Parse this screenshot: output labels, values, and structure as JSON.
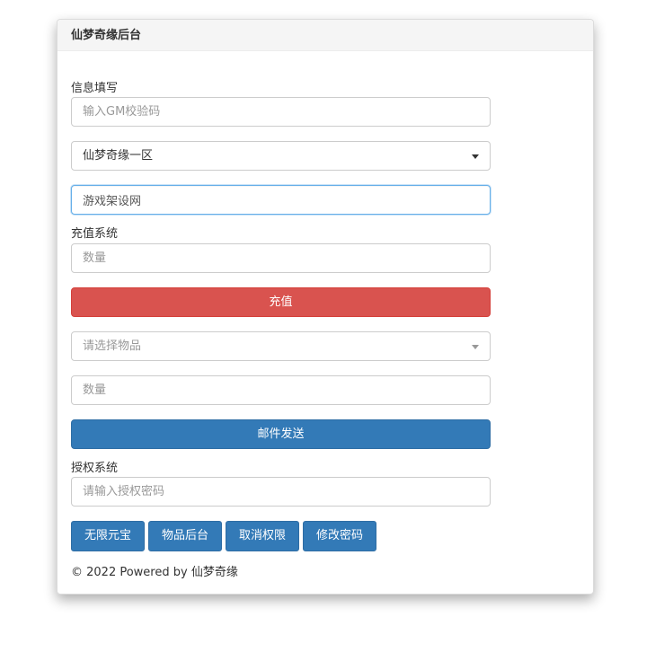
{
  "panel": {
    "title": "仙梦奇缘后台"
  },
  "info": {
    "section_label": "信息填写",
    "gm_code_placeholder": "输入GM校验码",
    "server_selected": "仙梦奇缘一区",
    "account_value": "游戏架设网"
  },
  "recharge": {
    "section_label": "充值系统",
    "amount_placeholder": "数量",
    "submit_label": "充值"
  },
  "mail": {
    "item_placeholder": "请选择物品",
    "quantity_placeholder": "数量",
    "submit_label": "邮件发送"
  },
  "auth": {
    "section_label": "授权系统",
    "password_placeholder": "请输入授权密码",
    "buttons": [
      {
        "label": "无限元宝"
      },
      {
        "label": "物品后台"
      },
      {
        "label": "取消权限"
      },
      {
        "label": "修改密码"
      }
    ]
  },
  "footer": {
    "text": "© 2022 Powered by 仙梦奇缘"
  },
  "colors": {
    "danger": "#d9534f",
    "primary": "#337ab7",
    "focus": "#66afe9"
  }
}
